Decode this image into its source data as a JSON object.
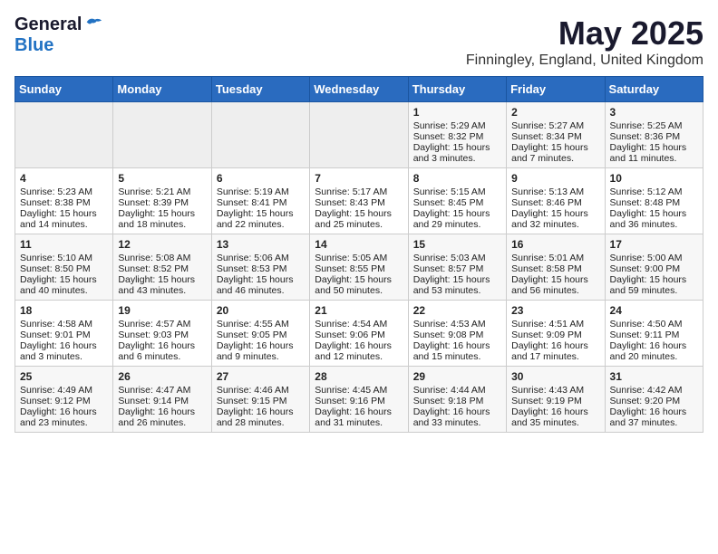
{
  "header": {
    "logo_general": "General",
    "logo_blue": "Blue",
    "month_title": "May 2025",
    "location": "Finningley, England, United Kingdom"
  },
  "weekdays": [
    "Sunday",
    "Monday",
    "Tuesday",
    "Wednesday",
    "Thursday",
    "Friday",
    "Saturday"
  ],
  "weeks": [
    [
      {
        "day": "",
        "content": ""
      },
      {
        "day": "",
        "content": ""
      },
      {
        "day": "",
        "content": ""
      },
      {
        "day": "",
        "content": ""
      },
      {
        "day": "1",
        "content": "Sunrise: 5:29 AM\nSunset: 8:32 PM\nDaylight: 15 hours\nand 3 minutes."
      },
      {
        "day": "2",
        "content": "Sunrise: 5:27 AM\nSunset: 8:34 PM\nDaylight: 15 hours\nand 7 minutes."
      },
      {
        "day": "3",
        "content": "Sunrise: 5:25 AM\nSunset: 8:36 PM\nDaylight: 15 hours\nand 11 minutes."
      }
    ],
    [
      {
        "day": "4",
        "content": "Sunrise: 5:23 AM\nSunset: 8:38 PM\nDaylight: 15 hours\nand 14 minutes."
      },
      {
        "day": "5",
        "content": "Sunrise: 5:21 AM\nSunset: 8:39 PM\nDaylight: 15 hours\nand 18 minutes."
      },
      {
        "day": "6",
        "content": "Sunrise: 5:19 AM\nSunset: 8:41 PM\nDaylight: 15 hours\nand 22 minutes."
      },
      {
        "day": "7",
        "content": "Sunrise: 5:17 AM\nSunset: 8:43 PM\nDaylight: 15 hours\nand 25 minutes."
      },
      {
        "day": "8",
        "content": "Sunrise: 5:15 AM\nSunset: 8:45 PM\nDaylight: 15 hours\nand 29 minutes."
      },
      {
        "day": "9",
        "content": "Sunrise: 5:13 AM\nSunset: 8:46 PM\nDaylight: 15 hours\nand 32 minutes."
      },
      {
        "day": "10",
        "content": "Sunrise: 5:12 AM\nSunset: 8:48 PM\nDaylight: 15 hours\nand 36 minutes."
      }
    ],
    [
      {
        "day": "11",
        "content": "Sunrise: 5:10 AM\nSunset: 8:50 PM\nDaylight: 15 hours\nand 40 minutes."
      },
      {
        "day": "12",
        "content": "Sunrise: 5:08 AM\nSunset: 8:52 PM\nDaylight: 15 hours\nand 43 minutes."
      },
      {
        "day": "13",
        "content": "Sunrise: 5:06 AM\nSunset: 8:53 PM\nDaylight: 15 hours\nand 46 minutes."
      },
      {
        "day": "14",
        "content": "Sunrise: 5:05 AM\nSunset: 8:55 PM\nDaylight: 15 hours\nand 50 minutes."
      },
      {
        "day": "15",
        "content": "Sunrise: 5:03 AM\nSunset: 8:57 PM\nDaylight: 15 hours\nand 53 minutes."
      },
      {
        "day": "16",
        "content": "Sunrise: 5:01 AM\nSunset: 8:58 PM\nDaylight: 15 hours\nand 56 minutes."
      },
      {
        "day": "17",
        "content": "Sunrise: 5:00 AM\nSunset: 9:00 PM\nDaylight: 15 hours\nand 59 minutes."
      }
    ],
    [
      {
        "day": "18",
        "content": "Sunrise: 4:58 AM\nSunset: 9:01 PM\nDaylight: 16 hours\nand 3 minutes."
      },
      {
        "day": "19",
        "content": "Sunrise: 4:57 AM\nSunset: 9:03 PM\nDaylight: 16 hours\nand 6 minutes."
      },
      {
        "day": "20",
        "content": "Sunrise: 4:55 AM\nSunset: 9:05 PM\nDaylight: 16 hours\nand 9 minutes."
      },
      {
        "day": "21",
        "content": "Sunrise: 4:54 AM\nSunset: 9:06 PM\nDaylight: 16 hours\nand 12 minutes."
      },
      {
        "day": "22",
        "content": "Sunrise: 4:53 AM\nSunset: 9:08 PM\nDaylight: 16 hours\nand 15 minutes."
      },
      {
        "day": "23",
        "content": "Sunrise: 4:51 AM\nSunset: 9:09 PM\nDaylight: 16 hours\nand 17 minutes."
      },
      {
        "day": "24",
        "content": "Sunrise: 4:50 AM\nSunset: 9:11 PM\nDaylight: 16 hours\nand 20 minutes."
      }
    ],
    [
      {
        "day": "25",
        "content": "Sunrise: 4:49 AM\nSunset: 9:12 PM\nDaylight: 16 hours\nand 23 minutes."
      },
      {
        "day": "26",
        "content": "Sunrise: 4:47 AM\nSunset: 9:14 PM\nDaylight: 16 hours\nand 26 minutes."
      },
      {
        "day": "27",
        "content": "Sunrise: 4:46 AM\nSunset: 9:15 PM\nDaylight: 16 hours\nand 28 minutes."
      },
      {
        "day": "28",
        "content": "Sunrise: 4:45 AM\nSunset: 9:16 PM\nDaylight: 16 hours\nand 31 minutes."
      },
      {
        "day": "29",
        "content": "Sunrise: 4:44 AM\nSunset: 9:18 PM\nDaylight: 16 hours\nand 33 minutes."
      },
      {
        "day": "30",
        "content": "Sunrise: 4:43 AM\nSunset: 9:19 PM\nDaylight: 16 hours\nand 35 minutes."
      },
      {
        "day": "31",
        "content": "Sunrise: 4:42 AM\nSunset: 9:20 PM\nDaylight: 16 hours\nand 37 minutes."
      }
    ]
  ]
}
